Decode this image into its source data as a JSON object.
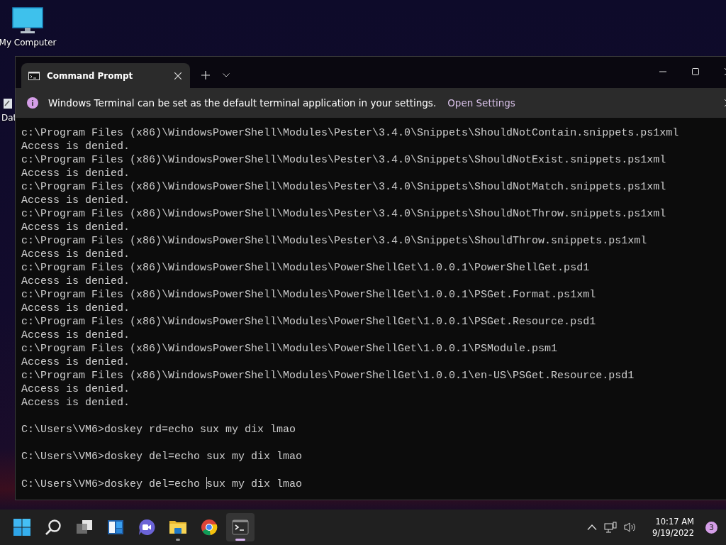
{
  "desktop": {
    "icons": [
      {
        "label": "My Computer",
        "kind": "monitor"
      },
      {
        "label": "Dat",
        "kind": "file"
      }
    ]
  },
  "window": {
    "tabs": [
      {
        "title": "Command Prompt",
        "selected": true
      }
    ],
    "info_bar": {
      "message": "Windows Terminal can be set as the default terminal application in your settings.",
      "link": "Open Settings"
    },
    "lines": [
      {
        "kind": "output",
        "text": "c:\\Program Files (x86)\\WindowsPowerShell\\Modules\\Pester\\3.4.0\\Snippets\\ShouldNotContain.snippets.ps1xml"
      },
      {
        "kind": "output",
        "text": "Access is denied."
      },
      {
        "kind": "output",
        "text": "c:\\Program Files (x86)\\WindowsPowerShell\\Modules\\Pester\\3.4.0\\Snippets\\ShouldNotExist.snippets.ps1xml"
      },
      {
        "kind": "output",
        "text": "Access is denied."
      },
      {
        "kind": "output",
        "text": "c:\\Program Files (x86)\\WindowsPowerShell\\Modules\\Pester\\3.4.0\\Snippets\\ShouldNotMatch.snippets.ps1xml"
      },
      {
        "kind": "output",
        "text": "Access is denied."
      },
      {
        "kind": "output",
        "text": "c:\\Program Files (x86)\\WindowsPowerShell\\Modules\\Pester\\3.4.0\\Snippets\\ShouldNotThrow.snippets.ps1xml"
      },
      {
        "kind": "output",
        "text": "Access is denied."
      },
      {
        "kind": "output",
        "text": "c:\\Program Files (x86)\\WindowsPowerShell\\Modules\\Pester\\3.4.0\\Snippets\\ShouldThrow.snippets.ps1xml"
      },
      {
        "kind": "output",
        "text": "Access is denied."
      },
      {
        "kind": "output",
        "text": "c:\\Program Files (x86)\\WindowsPowerShell\\Modules\\PowerShellGet\\1.0.0.1\\PowerShellGet.psd1"
      },
      {
        "kind": "output",
        "text": "Access is denied."
      },
      {
        "kind": "output",
        "text": "c:\\Program Files (x86)\\WindowsPowerShell\\Modules\\PowerShellGet\\1.0.0.1\\PSGet.Format.ps1xml"
      },
      {
        "kind": "output",
        "text": "Access is denied."
      },
      {
        "kind": "output",
        "text": "c:\\Program Files (x86)\\WindowsPowerShell\\Modules\\PowerShellGet\\1.0.0.1\\PSGet.Resource.psd1"
      },
      {
        "kind": "output",
        "text": "Access is denied."
      },
      {
        "kind": "output",
        "text": "c:\\Program Files (x86)\\WindowsPowerShell\\Modules\\PowerShellGet\\1.0.0.1\\PSModule.psm1"
      },
      {
        "kind": "output",
        "text": "Access is denied."
      },
      {
        "kind": "output",
        "text": "c:\\Program Files (x86)\\WindowsPowerShell\\Modules\\PowerShellGet\\1.0.0.1\\en-US\\PSGet.Resource.psd1"
      },
      {
        "kind": "output",
        "text": "Access is denied."
      },
      {
        "kind": "output",
        "text": "Access is denied."
      },
      {
        "kind": "blank"
      },
      {
        "kind": "command",
        "text": "C:\\Users\\VM6>doskey rd=echo sux my dix lmao"
      },
      {
        "kind": "blank"
      },
      {
        "kind": "command",
        "text": "C:\\Users\\VM6>doskey del=echo sux my dix lmao"
      },
      {
        "kind": "blank"
      },
      {
        "kind": "input",
        "before": "C:\\Users\\VM6>doskey del=echo ",
        "after": "sux my dix lmao"
      }
    ]
  },
  "taskbar": {
    "apps": [
      {
        "kind": "start",
        "running": false,
        "selected": false
      },
      {
        "kind": "search",
        "running": false,
        "selected": false
      },
      {
        "kind": "task-view",
        "running": false,
        "selected": false
      },
      {
        "kind": "widgets",
        "running": false,
        "selected": false
      },
      {
        "kind": "chat",
        "running": false,
        "selected": false
      },
      {
        "kind": "folder",
        "running": true,
        "selected": false
      },
      {
        "kind": "browser",
        "running": false,
        "selected": false
      },
      {
        "kind": "terminal",
        "running": true,
        "selected": true
      }
    ],
    "clock": {
      "time": "10:17 AM",
      "date": "9/19/2022"
    },
    "notification_count": "3"
  }
}
